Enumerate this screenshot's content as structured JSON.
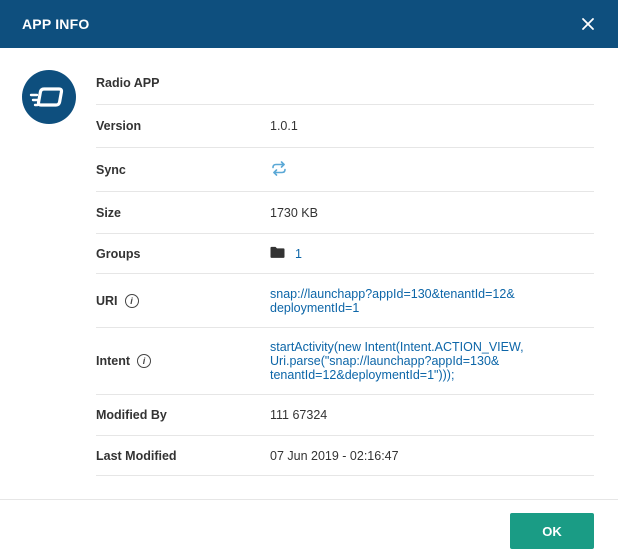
{
  "dialog": {
    "title": "APP INFO",
    "close_icon": "close-icon",
    "ok_label": "OK"
  },
  "app": {
    "name": "Radio APP",
    "icon": "app-logo-icon"
  },
  "fields": {
    "version_label": "Version",
    "version_value": "1.0.1",
    "sync_label": "Sync",
    "sync_icon": "sync-icon",
    "size_label": "Size",
    "size_value": "1730 KB",
    "groups_label": "Groups",
    "groups_icon": "folder-icon",
    "groups_count": "1",
    "uri_label": "URI",
    "uri_line1": "snap://launchapp?appId=130&tenantId=12&",
    "uri_line2": "deploymentId=1",
    "intent_label": "Intent",
    "intent_line1": "startActivity(new Intent(Intent.ACTION_VIEW,",
    "intent_line2": "Uri.parse(\"snap://launchapp?appId=130&",
    "intent_line3": "tenantId=12&deploymentId=1\")));",
    "modified_by_label": "Modified By",
    "modified_by_value": "111 67324",
    "last_modified_label": "Last Modified",
    "last_modified_value": "07 Jun 2019 - 02:16:47",
    "info_glyph": "i"
  },
  "colors": {
    "header": "#0e4f7e",
    "link": "#0d66a8",
    "ok_button": "#1a9c85"
  }
}
